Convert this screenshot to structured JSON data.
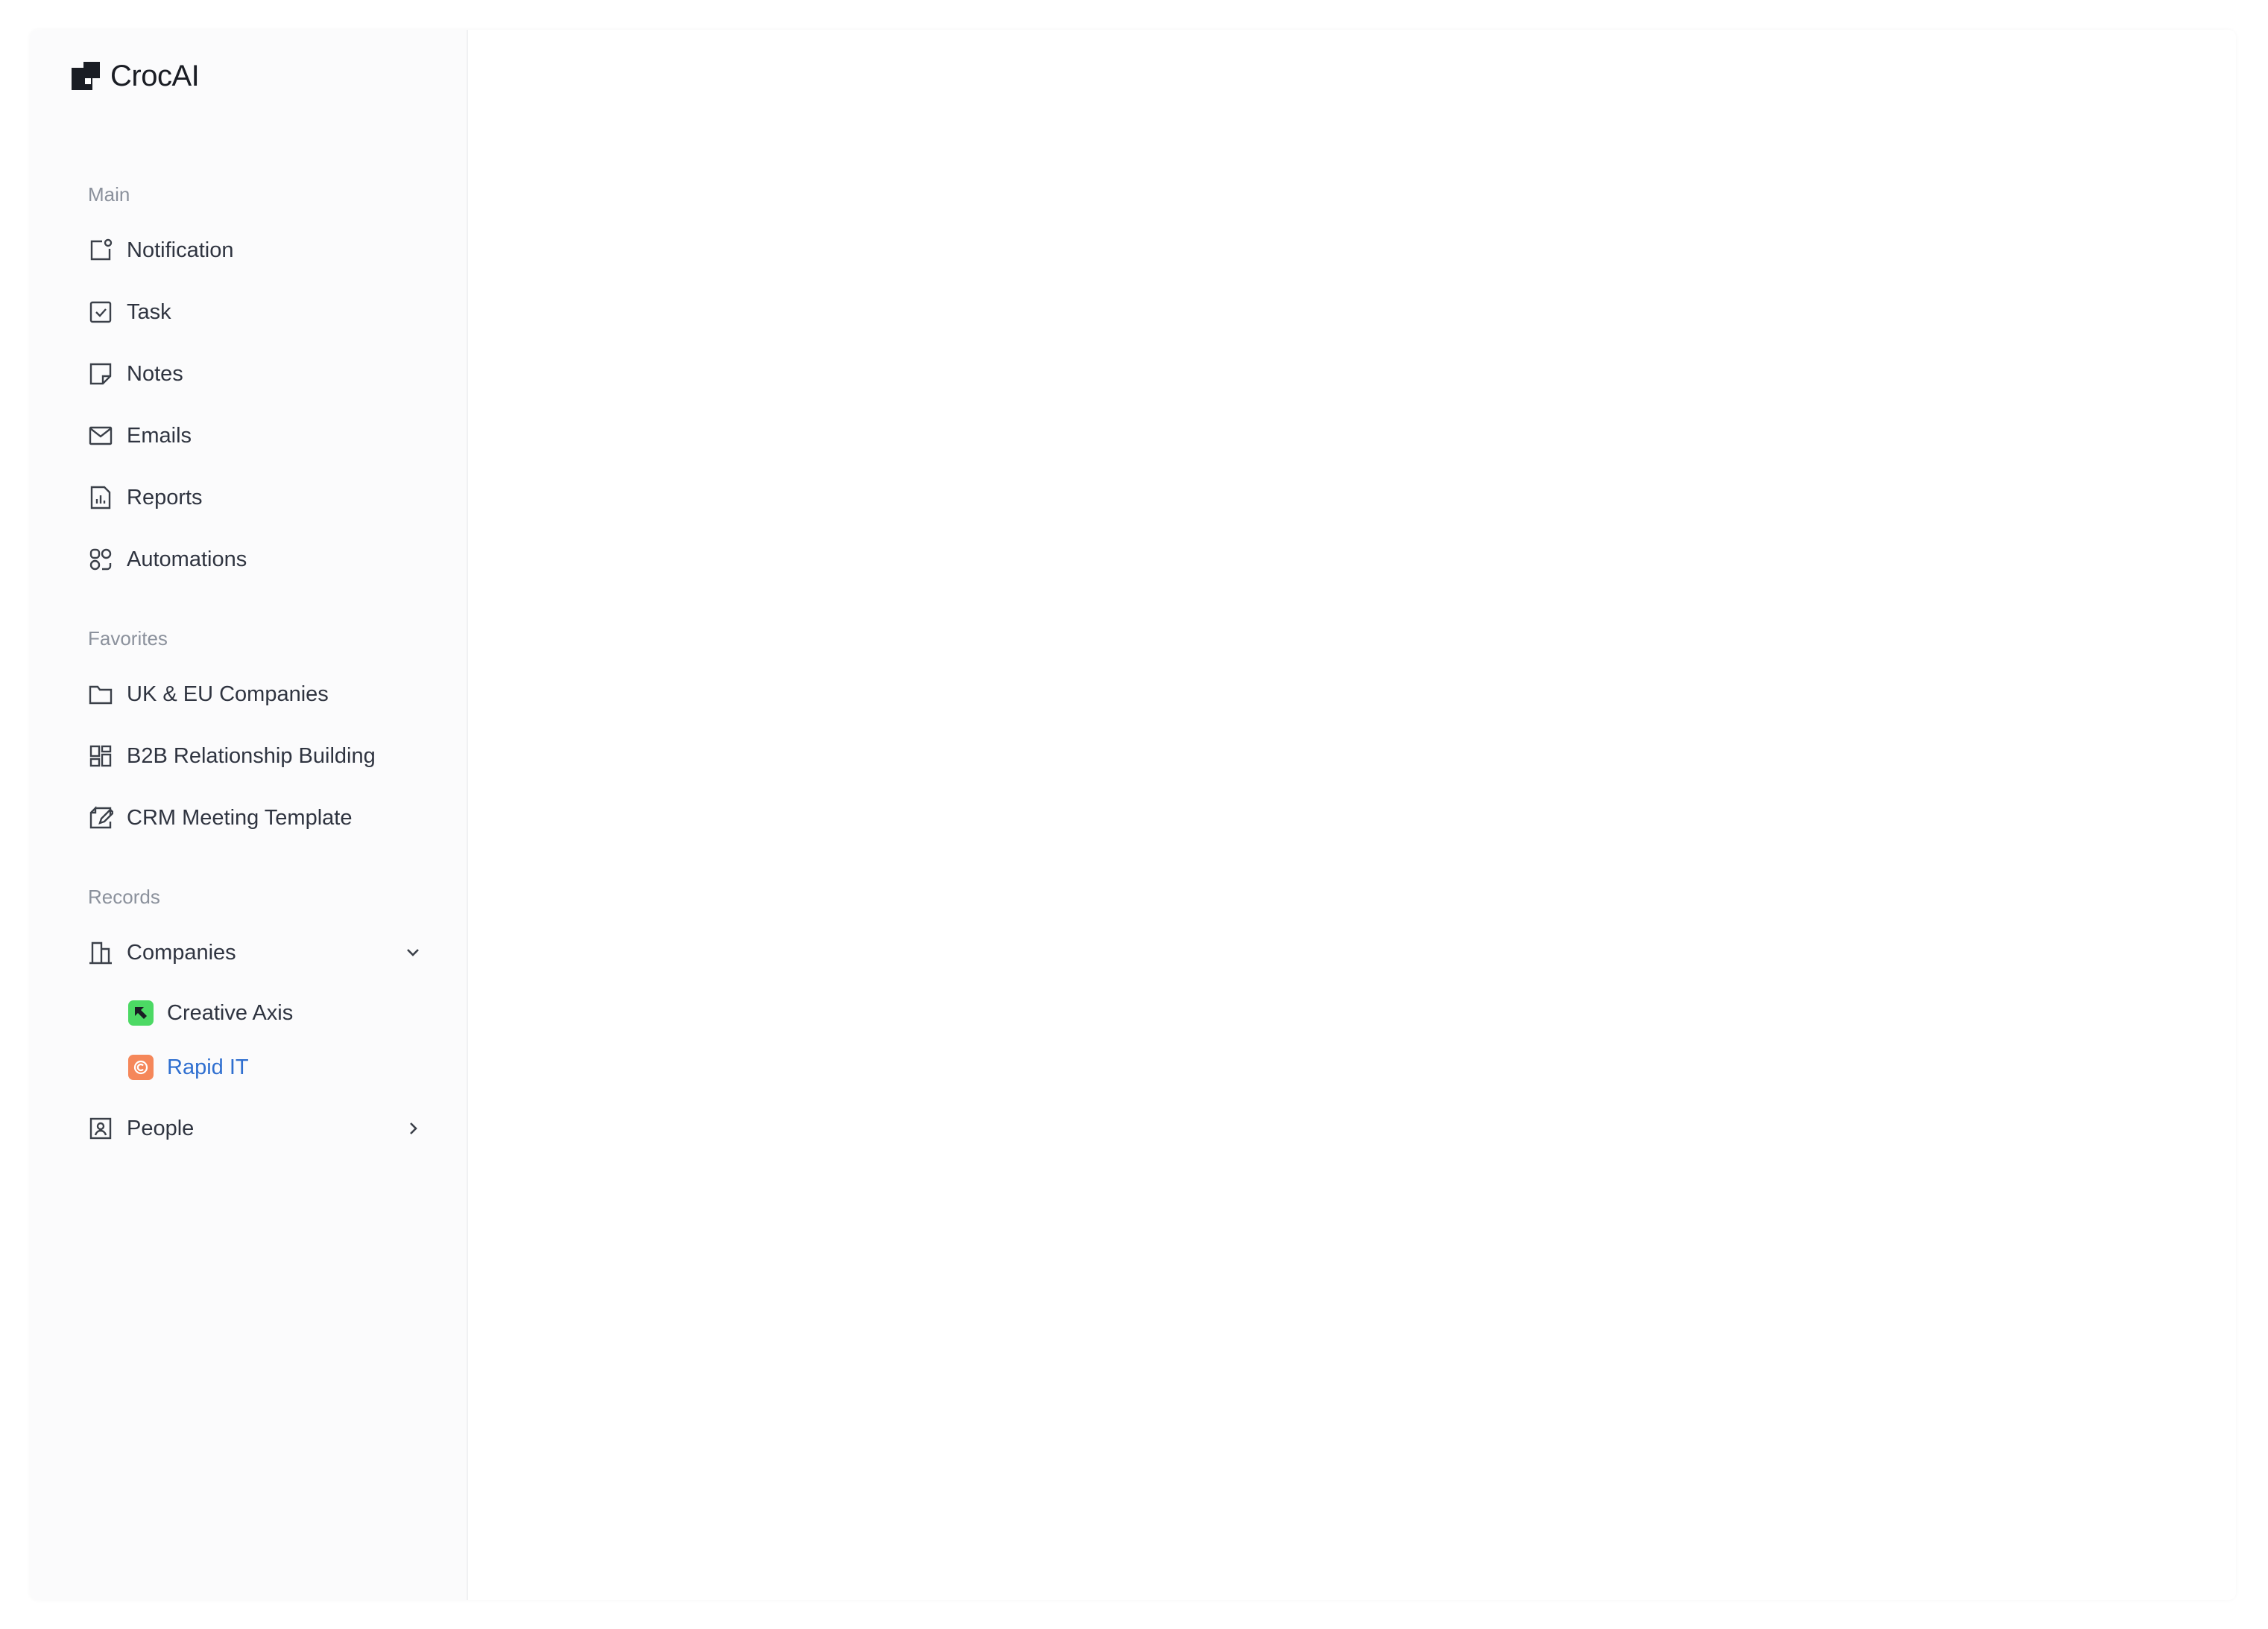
{
  "brand": {
    "name": "CrocAI"
  },
  "sidebar": {
    "sections": {
      "main": "Main",
      "favorites": "Favorites",
      "records": "Records"
    },
    "main_items": [
      {
        "label": "Notification",
        "icon": "notification-icon"
      },
      {
        "label": "Task",
        "icon": "task-checkbox-icon"
      },
      {
        "label": "Notes",
        "icon": "note-icon"
      },
      {
        "label": "Emails",
        "icon": "mail-icon"
      },
      {
        "label": "Reports",
        "icon": "report-chart-icon"
      },
      {
        "label": "Automations",
        "icon": "automations-icon"
      }
    ],
    "favorite_items": [
      {
        "label": "UK & EU Companies",
        "icon": "folder-icon"
      },
      {
        "label": "B2B Relationship Building",
        "icon": "dashboard-grid-icon"
      },
      {
        "label": "CRM Meeting Template",
        "icon": "template-edit-icon"
      }
    ],
    "records": {
      "companies": {
        "label": "Companies",
        "icon": "building-icon",
        "expanded": true,
        "children": [
          {
            "label": "Creative Axis",
            "color": "#2f3440",
            "badge_color": "#4cd964"
          },
          {
            "label": "Rapid IT",
            "color": "#2f6fd0",
            "badge_color": "#f5875a"
          }
        ]
      },
      "people": {
        "label": "People",
        "icon": "contact-card-icon",
        "expanded": false
      }
    }
  }
}
